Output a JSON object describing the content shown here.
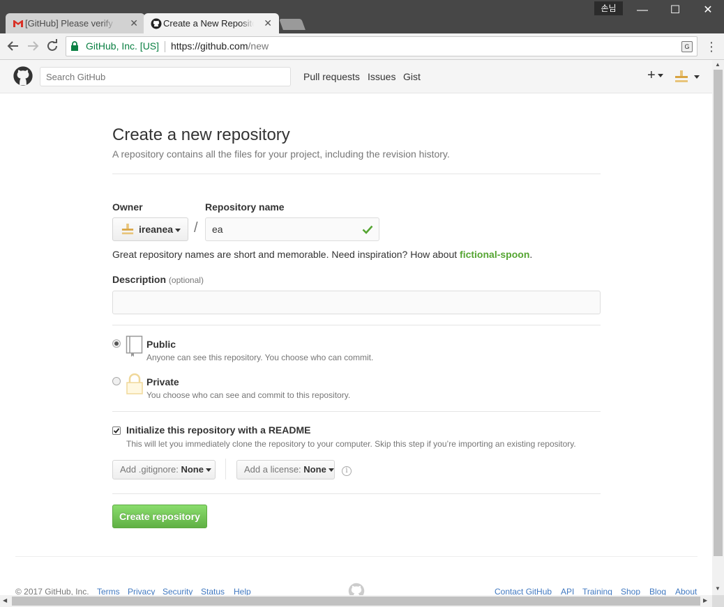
{
  "window": {
    "user_badge": "손님",
    "minimize": "—",
    "maximize": "☐",
    "close": "✕"
  },
  "tabs": [
    {
      "label": "[GitHub] Please verify your",
      "close": "✕"
    },
    {
      "label": "Create a New Repository",
      "close": "✕"
    }
  ],
  "toolbar": {
    "secure_label": "GitHub, Inc. [US]",
    "url_host": "https://github.com",
    "url_path": "/new",
    "translate": "G",
    "menu": "⋮"
  },
  "gh_header": {
    "search_placeholder": "Search GitHub",
    "nav": [
      "Pull requests",
      "Issues",
      "Gist"
    ],
    "plus": "+"
  },
  "page": {
    "title": "Create a new repository",
    "subtitle": "A repository contains all the files for your project, including the revision history."
  },
  "form": {
    "owner_label": "Owner",
    "owner_value": "ireanea",
    "separator": "/",
    "repo_name_label": "Repository name",
    "repo_name_value": "ea",
    "hint_text": "Great repository names are short and memorable. Need inspiration? How about ",
    "hint_suggestion": "fictional-spoon",
    "hint_end": ".",
    "description_label": "Description",
    "description_optional": "(optional)",
    "description_value": "",
    "visibility": [
      {
        "title": "Public",
        "note": "Anyone can see this repository. You choose who can commit.",
        "selected": true
      },
      {
        "title": "Private",
        "note": "You choose who can see and commit to this repository.",
        "selected": false
      }
    ],
    "readme_label": "Initialize this repository with a README",
    "readme_note": "This will let you immediately clone the repository to your computer. Skip this step if you’re importing an existing repository.",
    "readme_checked": true,
    "gitignore_label": "Add .gitignore:",
    "gitignore_value": "None",
    "license_label": "Add a license:",
    "license_value": "None",
    "info": "i",
    "submit": "Create repository"
  },
  "footer": {
    "copyright": "© 2017 GitHub, Inc.",
    "left_links": [
      "Terms",
      "Privacy",
      "Security",
      "Status",
      "Help"
    ],
    "right_links": [
      "Contact GitHub",
      "API",
      "Training",
      "Shop",
      "Blog",
      "About"
    ]
  },
  "colors": {
    "accent_green": "#55a532",
    "button_green": "#60b044",
    "link_blue": "#4078c0",
    "secure_green": "#0b8043"
  }
}
